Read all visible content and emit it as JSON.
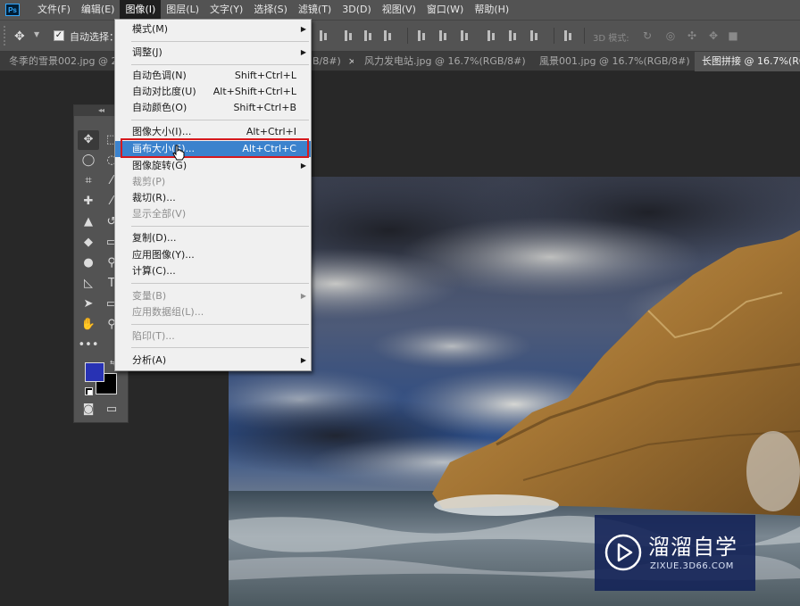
{
  "app": {
    "logo": "Ps"
  },
  "menubar": {
    "items": [
      "文件(F)",
      "编辑(E)",
      "图像(I)",
      "图层(L)",
      "文字(Y)",
      "选择(S)",
      "滤镜(T)",
      "3D(D)",
      "视图(V)",
      "窗口(W)",
      "帮助(H)"
    ],
    "active": "图像(I)"
  },
  "options": {
    "auto_select_label": "自动选择：",
    "auto_select_checked": true,
    "mode_3d_label": "3D 模式:"
  },
  "tabs": [
    {
      "label": "冬季的雪景002.jpg @ 25",
      "active": false
    },
    {
      "label": "B/8#)",
      "active": false
    },
    {
      "label": "风力发电站.jpg @ 16.7%(RGB/8#)",
      "active": false
    },
    {
      "label": "風景001.jpg @ 16.7%(RGB/8#)",
      "active": false
    },
    {
      "label": "长图拼接 @ 16.7%(RGB/",
      "active": true
    }
  ],
  "image_menu": {
    "items": [
      {
        "label": "模式(M)",
        "shortcut": "",
        "submenu": true,
        "disabled": false
      },
      {
        "label": "调整(J)",
        "shortcut": "",
        "submenu": true,
        "disabled": false
      },
      {
        "label": "自动色调(N)",
        "shortcut": "Shift+Ctrl+L",
        "submenu": false,
        "disabled": false
      },
      {
        "label": "自动对比度(U)",
        "shortcut": "Alt+Shift+Ctrl+L",
        "submenu": false,
        "disabled": false
      },
      {
        "label": "自动颜色(O)",
        "shortcut": "Shift+Ctrl+B",
        "submenu": false,
        "disabled": false
      },
      {
        "label": "图像大小(I)...",
        "shortcut": "Alt+Ctrl+I",
        "submenu": false,
        "disabled": false
      },
      {
        "label": "画布大小(S)...",
        "shortcut": "Alt+Ctrl+C",
        "submenu": false,
        "disabled": false,
        "highlighted": true
      },
      {
        "label": "图像旋转(G)",
        "shortcut": "",
        "submenu": true,
        "disabled": false
      },
      {
        "label": "裁剪(P)",
        "shortcut": "",
        "submenu": false,
        "disabled": true
      },
      {
        "label": "裁切(R)...",
        "shortcut": "",
        "submenu": false,
        "disabled": false
      },
      {
        "label": "显示全部(V)",
        "shortcut": "",
        "submenu": false,
        "disabled": true
      },
      {
        "label": "复制(D)...",
        "shortcut": "",
        "submenu": false,
        "disabled": false
      },
      {
        "label": "应用图像(Y)...",
        "shortcut": "",
        "submenu": false,
        "disabled": false
      },
      {
        "label": "计算(C)...",
        "shortcut": "",
        "submenu": false,
        "disabled": false
      },
      {
        "label": "变量(B)",
        "shortcut": "",
        "submenu": true,
        "disabled": true
      },
      {
        "label": "应用数据组(L)...",
        "shortcut": "",
        "submenu": false,
        "disabled": true
      },
      {
        "label": "陷印(T)...",
        "shortcut": "",
        "submenu": false,
        "disabled": true
      },
      {
        "label": "分析(A)",
        "shortcut": "",
        "submenu": true,
        "disabled": false
      }
    ]
  },
  "colors": {
    "foreground": "#2832b4",
    "background": "#000000",
    "highlight": "#3b82cd",
    "callout": "#d6191d"
  },
  "watermark": {
    "title": "溜溜自学",
    "subtitle": "ZIXUE.3D66.COM"
  },
  "icons": {
    "tools": [
      "move-tool-icon",
      "marquee-tool-icon",
      "lasso-tool-icon",
      "quick-select-icon",
      "crop-tool-icon",
      "eyedropper-icon",
      "healing-brush-icon",
      "brush-icon",
      "stamp-icon",
      "history-brush-icon",
      "eraser-icon",
      "gradient-icon",
      "blur-icon",
      "dodge-icon",
      "pen-icon",
      "type-icon",
      "path-select-icon",
      "shape-icon",
      "hand-icon",
      "zoom-icon",
      "more-tools-icon"
    ]
  }
}
